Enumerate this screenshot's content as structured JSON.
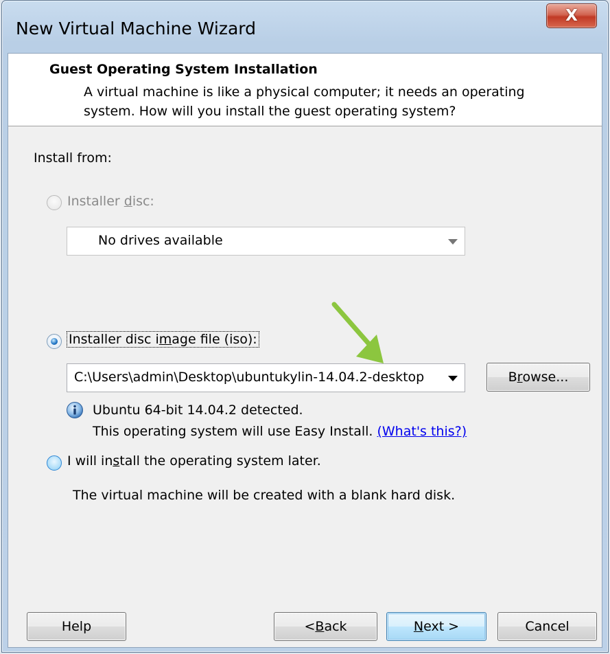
{
  "window": {
    "title": "New Virtual Machine Wizard",
    "close_glyph": "X"
  },
  "header": {
    "title": "Guest Operating System Installation",
    "description": "A virtual machine is like a physical computer; it needs an operating system. How will you install the guest operating system?"
  },
  "install_from": {
    "label": "Install from:"
  },
  "installer_disc": {
    "label_pre": "Installer ",
    "label_accel": "d",
    "label_post": "isc:",
    "selected": false,
    "enabled": false,
    "combo_value": "No drives available"
  },
  "disc_image": {
    "label_pre": "Installer disc i",
    "label_accel": "m",
    "label_post": "age file (iso):",
    "selected": true,
    "path_value": "C:\\Users\\admin\\Desktop\\ubuntukylin-14.04.2-desktop",
    "browse_pre": "B",
    "browse_accel": "r",
    "browse_post": "owse...",
    "detected_text": "Ubuntu 64-bit 14.04.2 detected.",
    "easy_install_text": "This operating system will use Easy Install. ",
    "whats_this_link": "(What's this?)",
    "info_icon": "info-icon"
  },
  "install_later": {
    "label_pre": "I will in",
    "label_accel": "s",
    "label_post": "tall the operating system later.",
    "selected": false,
    "description": "The virtual machine will be created with a blank hard disk."
  },
  "footer": {
    "help_label": "Help",
    "back_pre": "< ",
    "back_accel": "B",
    "back_post": "ack",
    "next_accel": "N",
    "next_post": "ext >",
    "cancel_label": "Cancel"
  },
  "colors": {
    "arrow_annotation": "#8cc63f",
    "link": "#0000ee",
    "close_button": "#c7442e"
  }
}
